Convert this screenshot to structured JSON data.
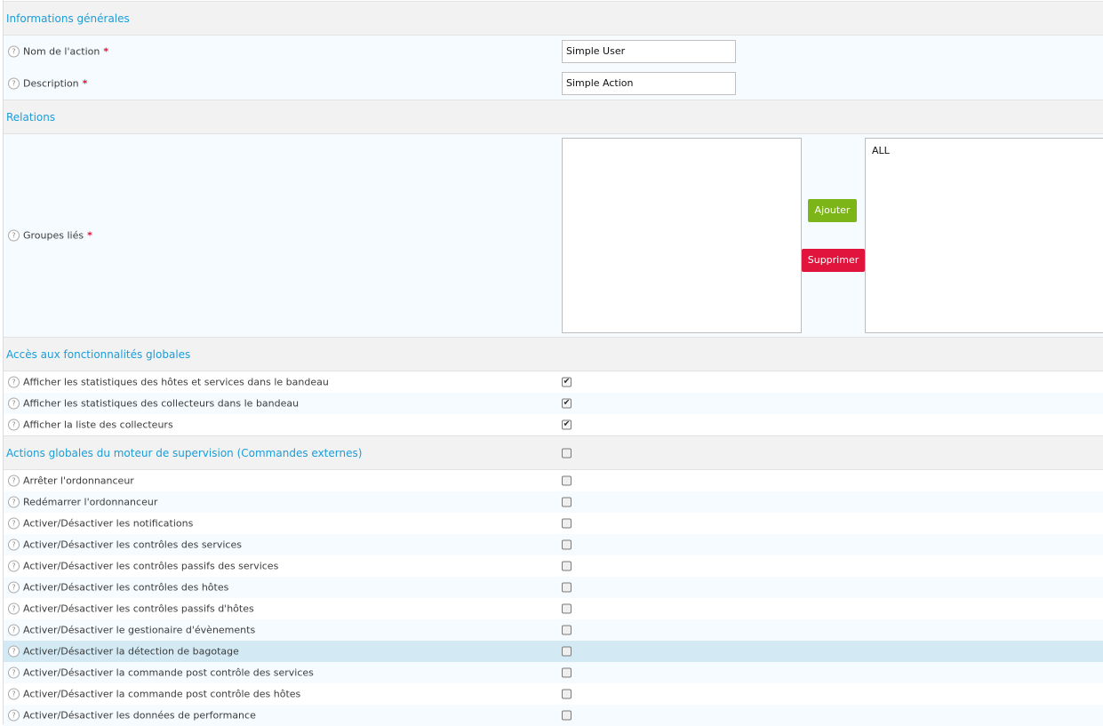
{
  "sections": {
    "general": "Informations générales",
    "relations": "Relations",
    "global_access": "Accès aux fonctionnalités globales",
    "global_actions": "Actions globales du moteur de supervision (Commandes externes)"
  },
  "fields": {
    "action_name": {
      "label": "Nom de l'action",
      "required": "*",
      "value": "Simple User"
    },
    "description": {
      "label": "Description",
      "required": "*",
      "value": "Simple Action"
    },
    "linked_groups": {
      "label": "Groupes liés",
      "required": "*",
      "available": [],
      "selected": [
        "ALL"
      ]
    }
  },
  "buttons": {
    "add": "Ajouter",
    "remove": "Supprimer"
  },
  "help_icon": "?",
  "check_glyph": "✔",
  "colors": {
    "section_title": "#1a9dd9",
    "add_button": "#7cb518",
    "remove_button": "#e0143c",
    "required": "#e0143c",
    "highlight_row": "#d3eaf5"
  },
  "global_access_items": [
    {
      "label": "Afficher les statistiques des hôtes et services dans le bandeau",
      "checked": true
    },
    {
      "label": "Afficher les statistiques des collecteurs dans le bandeau",
      "checked": true
    },
    {
      "label": "Afficher la liste des collecteurs",
      "checked": true
    }
  ],
  "global_actions_all_checked": false,
  "global_actions_items": [
    {
      "label": "Arrêter l'ordonnanceur",
      "checked": false
    },
    {
      "label": "Redémarrer l'ordonnanceur",
      "checked": false
    },
    {
      "label": "Activer/Désactiver les notifications",
      "checked": false
    },
    {
      "label": "Activer/Désactiver les contrôles des services",
      "checked": false
    },
    {
      "label": "Activer/Désactiver les contrôles passifs des services",
      "checked": false
    },
    {
      "label": "Activer/Désactiver les contrôles des hôtes",
      "checked": false
    },
    {
      "label": "Activer/Désactiver les contrôles passifs d'hôtes",
      "checked": false
    },
    {
      "label": "Activer/Désactiver le gestionaire d'évènements",
      "checked": false
    },
    {
      "label": "Activer/Désactiver la détection de bagotage",
      "checked": false,
      "highlighted": true
    },
    {
      "label": "Activer/Désactiver la commande post contrôle des services",
      "checked": false
    },
    {
      "label": "Activer/Désactiver la commande post contrôle des hôtes",
      "checked": false
    },
    {
      "label": "Activer/Désactiver les données de performance",
      "checked": false
    }
  ]
}
